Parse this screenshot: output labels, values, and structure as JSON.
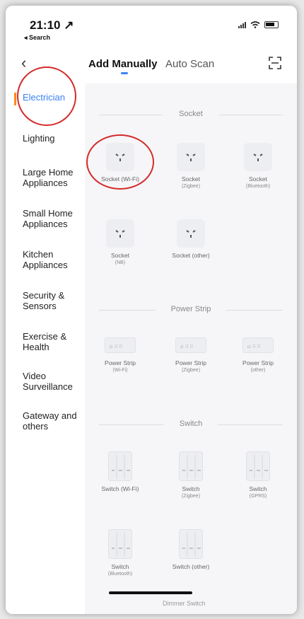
{
  "status": {
    "time": "21:10 ↗",
    "back_app": "◂ Search"
  },
  "nav": {
    "back": "‹",
    "tab_manual": "Add Manually",
    "tab_auto": "Auto Scan",
    "scan_icon": "scan-icon"
  },
  "sidebar": {
    "items": [
      {
        "label": "Electrician"
      },
      {
        "label": "Lighting"
      },
      {
        "label": "Large Home Appliances"
      },
      {
        "label": "Small Home Appliances"
      },
      {
        "label": "Kitchen Appliances"
      },
      {
        "label": "Security & Sensors"
      },
      {
        "label": "Exercise & Health"
      },
      {
        "label": "Video Surveillance"
      },
      {
        "label": "Gateway and others"
      }
    ]
  },
  "sections": {
    "socket": "Socket",
    "power_strip": "Power Strip",
    "switch": "Switch"
  },
  "devices": {
    "socket_wifi": {
      "name": "Socket (Wi-Fi)"
    },
    "socket_zigbee": {
      "name": "Socket",
      "sub": "(Zigbee)"
    },
    "socket_bluetooth": {
      "name": "Socket",
      "sub": "(Bluetooth)"
    },
    "socket_nb": {
      "name": "Socket",
      "sub": "(NB)"
    },
    "socket_other": {
      "name": "Socket (other)"
    },
    "strip_wifi": {
      "name": "Power Strip",
      "sub": "(Wi-Fi)"
    },
    "strip_zigbee": {
      "name": "Power Strip",
      "sub": "(Zigbee)"
    },
    "strip_other": {
      "name": "Power Strip",
      "sub": "(other)"
    },
    "switch_wifi": {
      "name": "Switch (Wi-Fi)"
    },
    "switch_zigbee": {
      "name": "Switch",
      "sub": "(Zigbee)"
    },
    "switch_gprs": {
      "name": "Switch",
      "sub": "(GPRS)"
    },
    "switch_bluetooth": {
      "name": "Switch",
      "sub": "(Bluetooth)"
    },
    "switch_other": {
      "name": "Switch (other)"
    }
  },
  "peek_label": "Dimmer Switch",
  "colors": {
    "accent": "#3b82f6",
    "active_marker": "#ff8a1f",
    "annotation": "#d42b2b"
  }
}
